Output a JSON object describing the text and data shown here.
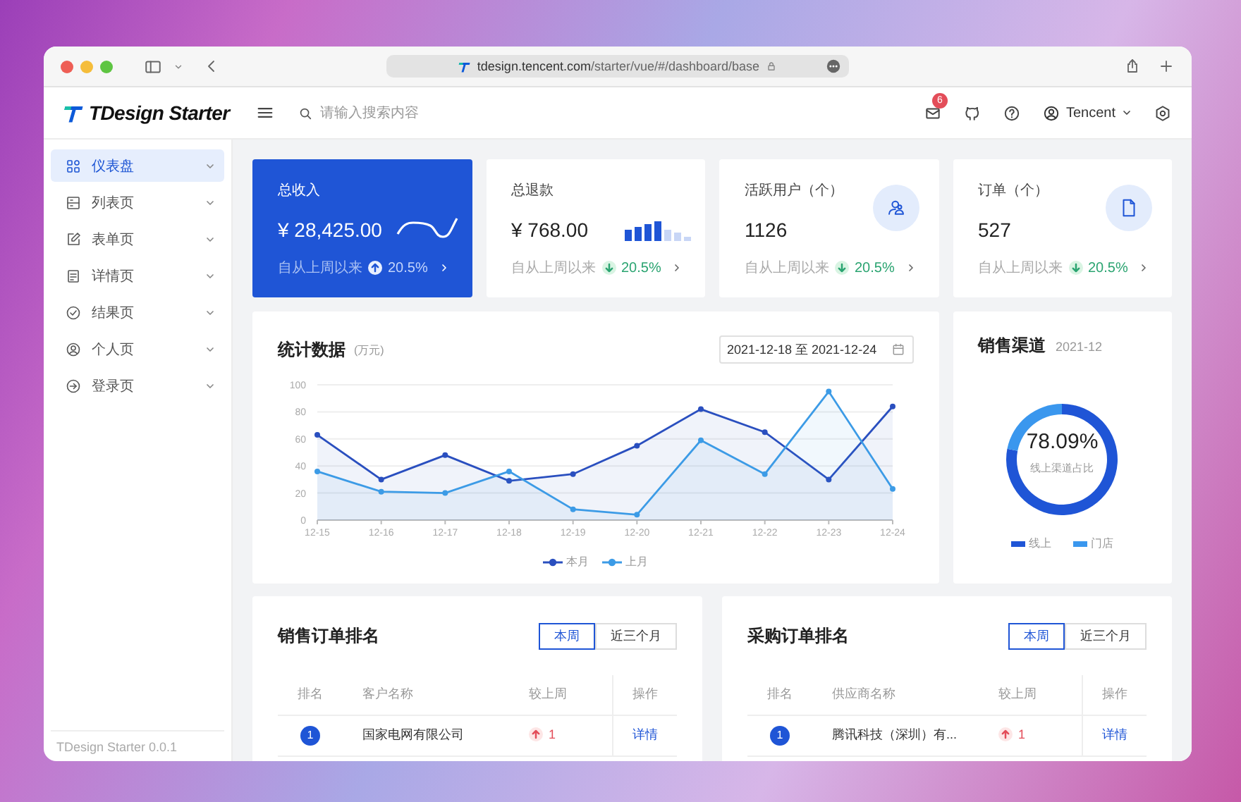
{
  "browser": {
    "url": "**tdesign.tencent.com**/starter/vue/#/dashboard/base"
  },
  "header": {
    "logo": "TDesign Starter",
    "search": {
      "placeholder": "请输入搜索内容"
    },
    "mail_badge": "6",
    "user": "Tencent"
  },
  "sidebar": {
    "items": [
      {
        "label": "仪表盘",
        "selected": true
      },
      {
        "label": "列表页",
        "selected": false
      },
      {
        "label": "表单页",
        "selected": false
      },
      {
        "label": "详情页",
        "selected": false
      },
      {
        "label": "结果页",
        "selected": false
      },
      {
        "label": "个人页",
        "selected": false
      },
      {
        "label": "登录页",
        "selected": false
      }
    ],
    "footer": "TDesign Starter 0.0.1"
  },
  "stats": [
    {
      "kind": "highlight",
      "title": "总收入",
      "value": "¥ 28,425.00",
      "note": "自从上周以来",
      "increase": true,
      "change": "20.5%"
    },
    {
      "kind": "bars",
      "title": "总退款",
      "value": "¥ 768.00",
      "note": "自从上周以来",
      "increase": false,
      "change": "20.5%"
    },
    {
      "kind": "icon",
      "title": "活跃用户（个）",
      "value": "1126",
      "note": "自从上周以来",
      "increase": false,
      "change": "20.5%"
    },
    {
      "kind": "icon",
      "title": "订单（个）",
      "value": "527",
      "note": "自从上周以来",
      "increase": false,
      "change": "20.5%"
    }
  ],
  "trend_chart": {
    "title": "统计数据",
    "unit": "(万元)",
    "date_range": "2021-12-18 至 2021-12-24",
    "chart_data": {
      "type": "area",
      "grid": true,
      "legend": true,
      "categories": [
        "12-15",
        "12-16",
        "12-17",
        "12-18",
        "12-19",
        "12-20",
        "12-21",
        "12-22",
        "12-23",
        "12-24"
      ],
      "series": [
        {
          "name": "本月",
          "color": "#2a4fbf",
          "marker": "circle",
          "values": [
            63,
            30,
            48,
            29,
            34,
            55,
            82,
            65,
            30,
            84
          ]
        },
        {
          "name": "上月",
          "color": "#3c9be6",
          "marker": "circle",
          "values": [
            36,
            21,
            20,
            36,
            8,
            4,
            59,
            34,
            95,
            23
          ]
        }
      ],
      "ylim": [
        0,
        100
      ],
      "yticks": [
        0,
        20,
        40,
        60,
        80,
        100
      ]
    }
  },
  "channel_chart": {
    "title": "销售渠道",
    "subtitle": "2021-12",
    "center_value": "78.09%",
    "center_label": "线上渠道占比",
    "chart_data": {
      "type": "donut",
      "categories": [
        "线上",
        "门店"
      ],
      "values": [
        78.09,
        21.91
      ],
      "colors": [
        "#1f55d6",
        "#3a97ee"
      ],
      "legend": true
    }
  },
  "rankings": [
    {
      "title": "销售订单排名",
      "tabs": [
        {
          "label": "本周",
          "selected": true
        },
        {
          "label": "近三个月",
          "selected": false
        }
      ],
      "columns": [
        "排名",
        "客户名称",
        "较上周",
        "操作"
      ],
      "rows": [
        {
          "rank": "1",
          "name": "国家电网有限公司",
          "increase": true,
          "change": "1",
          "action": "详情"
        }
      ]
    },
    {
      "title": "采购订单排名",
      "tabs": [
        {
          "label": "本周",
          "selected": true
        },
        {
          "label": "近三个月",
          "selected": false
        }
      ],
      "columns": [
        "排名",
        "供应商名称",
        "较上周",
        "操作"
      ],
      "rows": [
        {
          "rank": "1",
          "name": "腾讯科技（深圳）有...",
          "increase": true,
          "change": "1",
          "action": "详情"
        }
      ]
    }
  ]
}
